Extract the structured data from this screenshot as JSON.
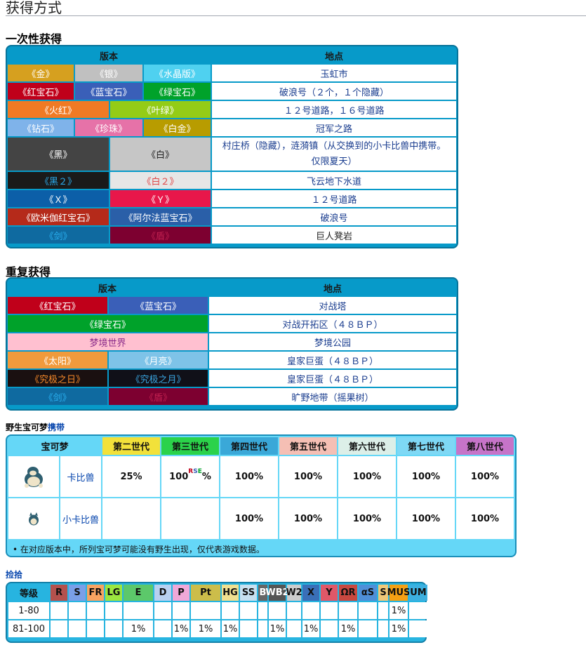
{
  "section_title": "获得方式",
  "once": {
    "title": "一次性获得",
    "col_version": "版本",
    "col_location": "地点",
    "rows": [
      {
        "versions": [
          "《金》",
          "《银》",
          "《水晶版》"
        ],
        "location": "玉虹市"
      },
      {
        "versions": [
          "《红宝石》",
          "《蓝宝石》",
          "《绿宝石》"
        ],
        "location": "破浪号（２个，１个隐藏）"
      },
      {
        "versions": [
          "《火红》",
          "《叶绿》"
        ],
        "location": "１２号道路，１６号道路"
      },
      {
        "versions": [
          "《钻石》",
          "《珍珠》",
          "《白金》"
        ],
        "location": "冠军之路"
      },
      {
        "versions": [
          "《黑》",
          "《白》"
        ],
        "location": "村庄桥（隐藏），涟漪镇（从交换到的小卡比兽中携带。仅限夏天）"
      },
      {
        "versions": [
          "《黑２》",
          "《白２》"
        ],
        "location": "飞云地下水道"
      },
      {
        "versions": [
          "《Ｘ》",
          "《Ｙ》"
        ],
        "location": "１２号道路"
      },
      {
        "versions": [
          "《欧米伽红宝石》",
          "《阿尔法蓝宝石》"
        ],
        "location": "破浪号"
      },
      {
        "versions": [
          "《剑》",
          "《盾》"
        ],
        "location": "巨人凳岩"
      }
    ]
  },
  "repeat": {
    "title": "重复获得",
    "col_version": "版本",
    "col_location": "地点",
    "rows": [
      {
        "versions": [
          "《红宝石》",
          "《蓝宝石》"
        ],
        "location": "对战塔"
      },
      {
        "versions": [
          "《绿宝石》"
        ],
        "location": "对战开拓区（４８ＢＰ）"
      },
      {
        "versions": [
          "梦境世界"
        ],
        "location": "梦境公园"
      },
      {
        "versions": [
          "《太阳》",
          "《月亮》"
        ],
        "location": "皇家巨蛋（４８ＢＰ）"
      },
      {
        "versions": [
          "《究极之日》",
          "《究极之月》"
        ],
        "location": "皇家巨蛋（４８ＢＰ）"
      },
      {
        "versions": [
          "《剑》",
          "《盾》"
        ],
        "location": "旷野地带（摇果树）"
      }
    ]
  },
  "wild": {
    "title_prefix": "野生宝可梦",
    "title_link": "携带",
    "col_pokemon": "宝可梦",
    "generations": [
      "第二世代",
      "第三世代",
      "第四世代",
      "第五世代",
      "第六世代",
      "第七世代",
      "第八世代"
    ],
    "rows": [
      {
        "name": "卡比兽",
        "icon": "snorlax-icon",
        "values": [
          "25%",
          "100",
          "100%",
          "100%",
          "100%",
          "100%",
          "100%"
        ],
        "superscript": [
          "R",
          "S",
          "E"
        ],
        "suffix": "%"
      },
      {
        "name": "小卡比兽",
        "icon": "munchlax-icon",
        "values": [
          "",
          "",
          "100%",
          "100%",
          "100%",
          "100%",
          "100%"
        ]
      }
    ],
    "note": "在对应版本中，所列宝可梦可能没有野生出现，仅代表游戏数据。"
  },
  "pickup": {
    "title": "捡拾",
    "col_level": "等级",
    "games": [
      "R",
      "S",
      "FR",
      "LG",
      "E",
      "D",
      "P",
      "Pt",
      "HG",
      "SS",
      "B",
      "WB2",
      "W2",
      "X",
      "Y",
      "ΩR",
      "αS",
      "S",
      "MUS",
      "UM"
    ],
    "rows": [
      {
        "level": "1-80",
        "values": [
          "",
          "",
          "",
          "",
          "",
          "",
          "",
          "",
          "",
          "",
          "",
          "",
          "",
          "",
          "",
          "",
          "",
          "",
          "1%",
          ""
        ]
      },
      {
        "level": "81-100",
        "values": [
          "",
          "",
          "",
          "",
          "1%",
          "",
          "1%",
          "1%",
          "1%",
          "",
          "",
          "1%",
          "",
          "1%",
          "",
          "1%",
          "",
          "",
          "1%",
          ""
        ]
      }
    ]
  },
  "colors": {
    "gold": "#d6a01f",
    "silver": "#c0c0c0",
    "crystal": "#4fd1f0",
    "ruby": "#c0001a",
    "sapphire": "#3a5fb8",
    "emerald": "#00a22a",
    "firered": "#f07a24",
    "leafgreen": "#94cc16",
    "diamond": "#7fb3ea",
    "pearl": "#e672a8",
    "platinum": "#b89c00",
    "black": "#444444",
    "white": "#e0e0e0",
    "x": "#0c5fa8",
    "y": "#e8174a",
    "sword": "#0f6aa0",
    "shield": "#7d0030",
    "frame": "#079ac9"
  }
}
